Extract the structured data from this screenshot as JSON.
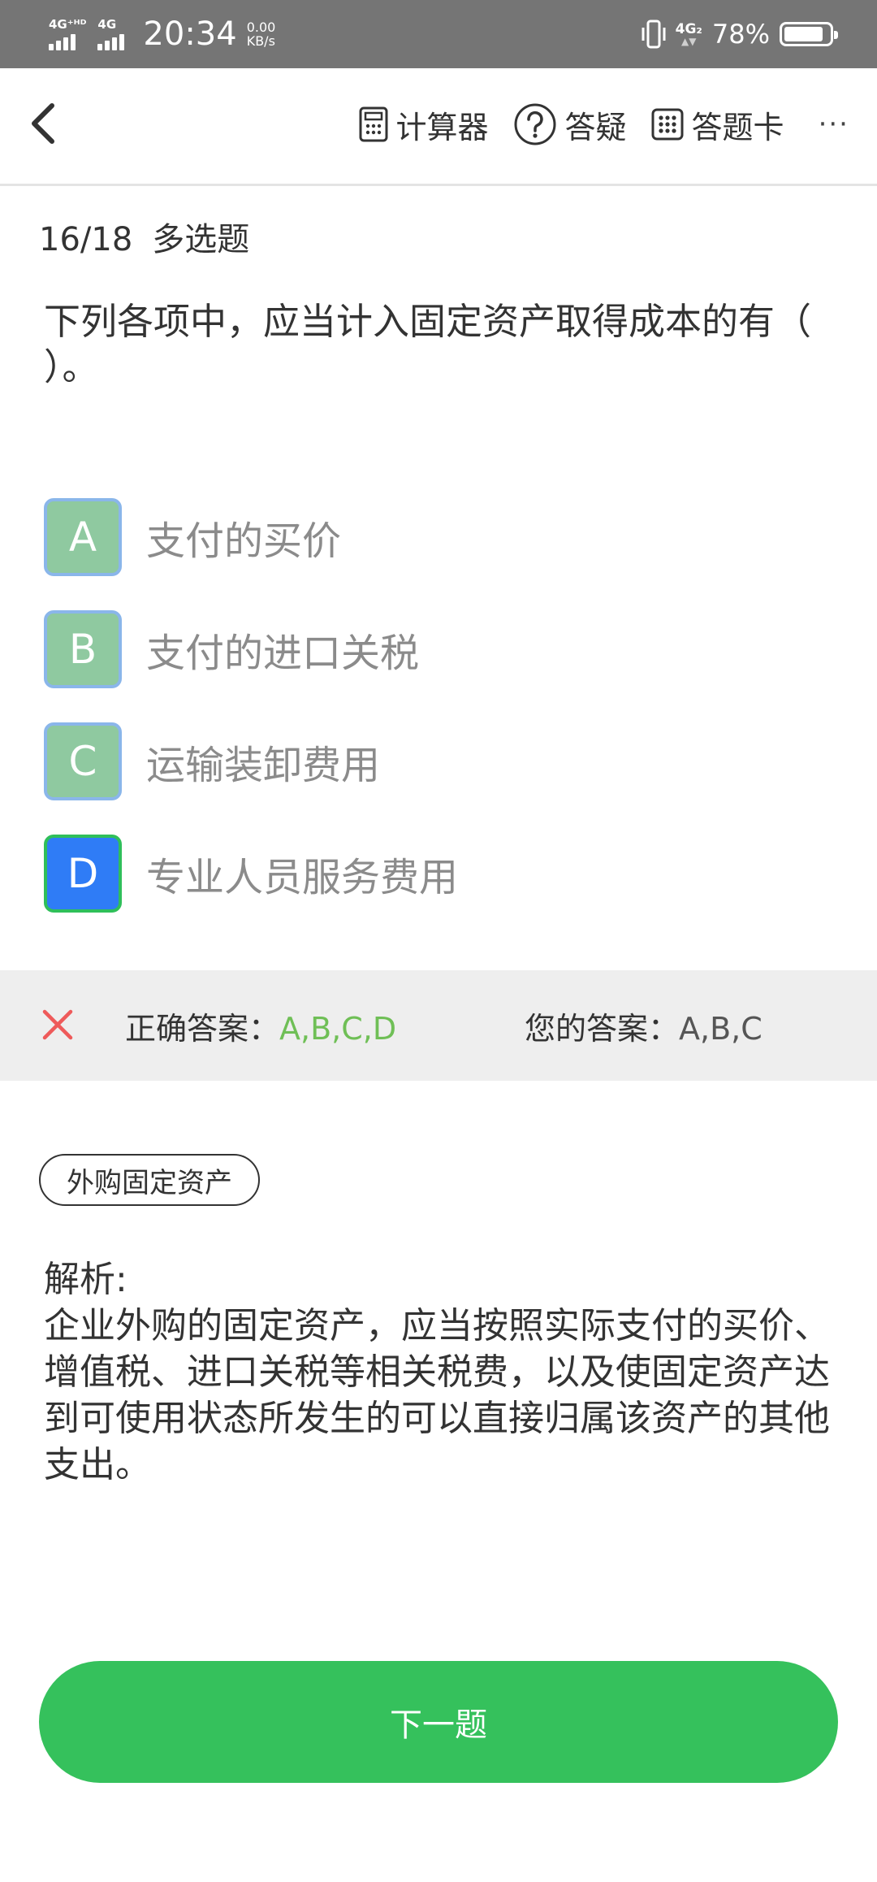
{
  "status_bar": {
    "net1": "4G⁺ᴴᴰ",
    "net2": "4G",
    "time": "20:34",
    "speed_value": "0.00",
    "speed_unit": "KB/s",
    "net_right": "4G₂",
    "battery_percent": "78%"
  },
  "nav": {
    "calculator": "计算器",
    "qa": "答疑",
    "answer_card": "答题卡",
    "more": "···"
  },
  "question": {
    "progress": "16/18",
    "type": "多选题",
    "stem": "下列各项中，应当计入固定资产取得成本的有（ ）。",
    "options": [
      {
        "letter": "A",
        "text": "支付的买价"
      },
      {
        "letter": "B",
        "text": "支付的进口关税"
      },
      {
        "letter": "C",
        "text": "运输装卸费用"
      },
      {
        "letter": "D",
        "text": "专业人员服务费用"
      }
    ]
  },
  "answer": {
    "correct_label": "正确答案：",
    "correct_value": "A,B,C,D",
    "your_label": "您的答案：",
    "your_value": "A,B,C"
  },
  "tag": "外购固定资产",
  "analysis": {
    "label": "解析:",
    "text": "企业外购的固定资产，应当按照实际支付的买价、增值税、进口关税等相关税费，以及使固定资产达到可使用状态所发生的可以直接归属该资产的其他支出。"
  },
  "next_button": "下一题",
  "colors": {
    "status_bar": "#757575",
    "option_selected": "#8fc9a0",
    "option_missed": "#2f7cf6",
    "correct_text": "#6fbf56",
    "wrong_icon": "#ee5a5a",
    "next_button": "#35c15c"
  },
  "icons": {
    "back": "chevron-left-icon",
    "calculator": "calculator-icon",
    "qa": "question-circle-icon",
    "answer_card": "grid-icon",
    "wrong": "close-icon"
  }
}
